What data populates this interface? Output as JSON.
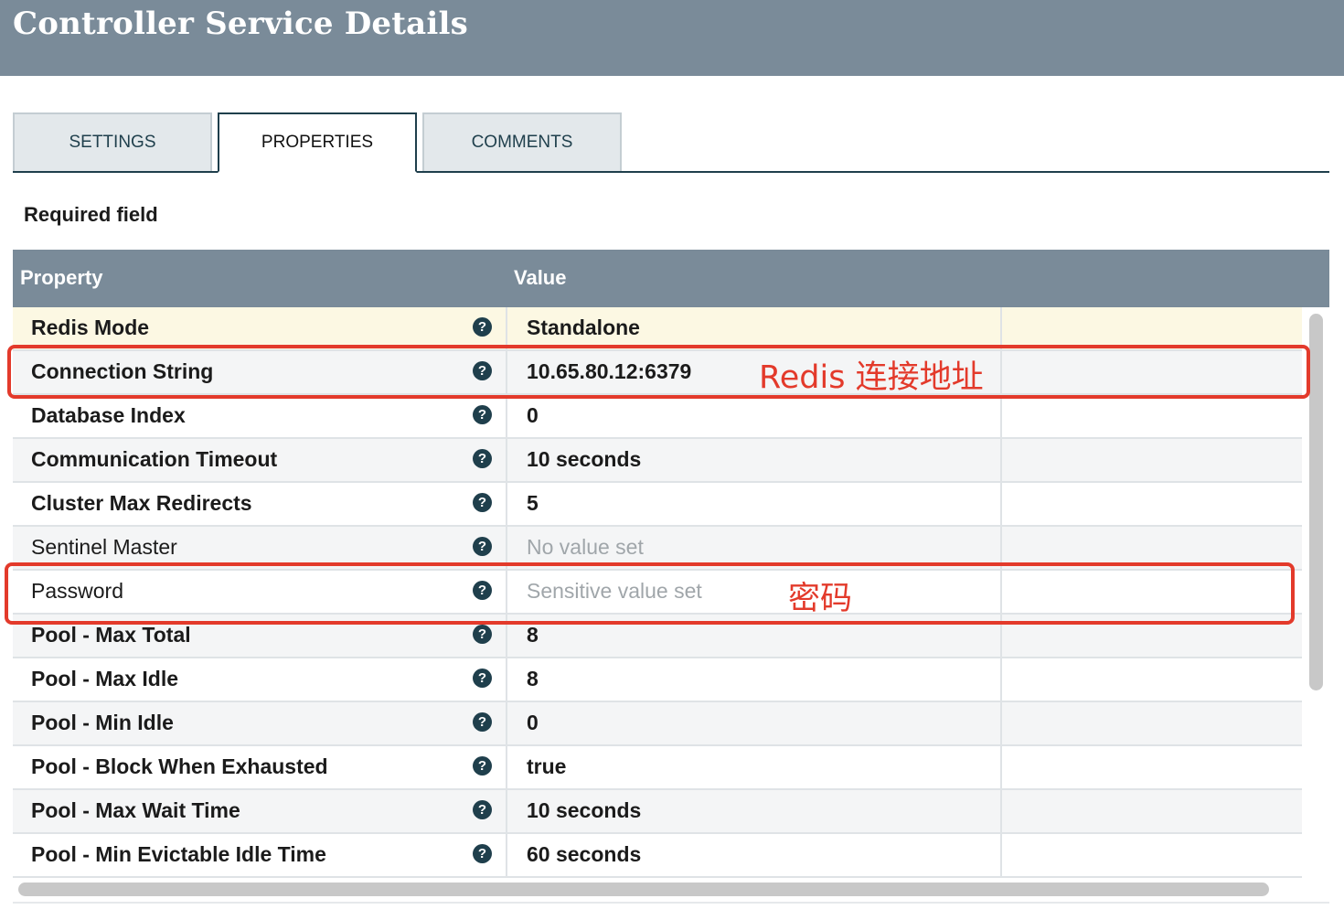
{
  "header": {
    "title": "Controller Service Details"
  },
  "tabs": [
    {
      "label": "SETTINGS",
      "active": false
    },
    {
      "label": "PROPERTIES",
      "active": true
    },
    {
      "label": "COMMENTS",
      "active": false
    }
  ],
  "required_field_label": "Required field",
  "grid": {
    "columns": [
      "Property",
      "Value"
    ],
    "rows": [
      {
        "name": "Redis Mode",
        "value": "Standalone",
        "required": true,
        "value_state": "set"
      },
      {
        "name": "Connection String",
        "value": "10.65.80.12:6379",
        "required": true,
        "value_state": "set"
      },
      {
        "name": "Database Index",
        "value": "0",
        "required": true,
        "value_state": "set"
      },
      {
        "name": "Communication Timeout",
        "value": "10 seconds",
        "required": true,
        "value_state": "set"
      },
      {
        "name": "Cluster Max Redirects",
        "value": "5",
        "required": true,
        "value_state": "set"
      },
      {
        "name": "Sentinel Master",
        "value": "No value set",
        "required": false,
        "value_state": "empty"
      },
      {
        "name": "Password",
        "value": "Sensitive value set",
        "required": false,
        "value_state": "sensitive"
      },
      {
        "name": "Pool - Max Total",
        "value": "8",
        "required": true,
        "value_state": "set"
      },
      {
        "name": "Pool - Max Idle",
        "value": "8",
        "required": true,
        "value_state": "set"
      },
      {
        "name": "Pool - Min Idle",
        "value": "0",
        "required": true,
        "value_state": "set"
      },
      {
        "name": "Pool - Block When Exhausted",
        "value": "true",
        "required": true,
        "value_state": "set"
      },
      {
        "name": "Pool - Max Wait Time",
        "value": "10 seconds",
        "required": true,
        "value_state": "set"
      },
      {
        "name": "Pool - Min Evictable Idle Time",
        "value": "60 seconds",
        "required": true,
        "value_state": "set"
      }
    ]
  },
  "annotations": {
    "connection": "Redis 连接地址",
    "password": "密码"
  },
  "colors": {
    "header_bg": "#7a8b99",
    "accent": "#1f3f4c",
    "annotation": "#e33a2b",
    "selected_row": "#fcf8e3"
  }
}
